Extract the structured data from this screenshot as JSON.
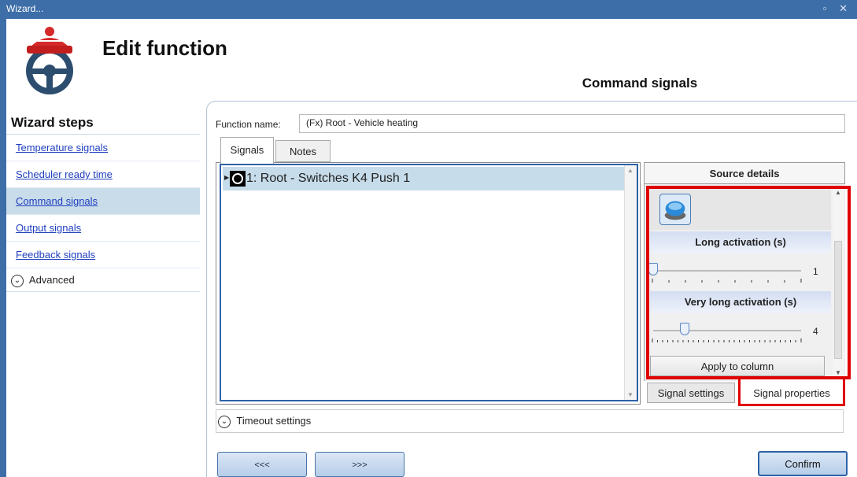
{
  "window": {
    "title": "Wizard...",
    "controls": "▫ ✕"
  },
  "header": {
    "title": "Edit function",
    "step_tab": "Command signals"
  },
  "sidebar": {
    "heading": "Wizard steps",
    "items": [
      {
        "label": "Temperature signals"
      },
      {
        "label": "Scheduler ready time"
      },
      {
        "label": "Command signals",
        "active": true
      },
      {
        "label": "Output signals"
      },
      {
        "label": "Feedback signals"
      }
    ],
    "advanced_label": "Advanced"
  },
  "form": {
    "function_name_label": "Function name:",
    "function_name_value": "(Fx) Root - Vehicle heating",
    "tabs": [
      {
        "label": "Signals"
      },
      {
        "label": "Notes"
      }
    ]
  },
  "signals": {
    "rows": [
      {
        "label": "1: Root - Switches K4 Push 1"
      }
    ]
  },
  "source": {
    "header": "Source details",
    "icon": "push-button-icon",
    "long_activation": {
      "title": "Long activation (s)",
      "value": "1",
      "min": 1,
      "max": 10
    },
    "very_long_activation": {
      "title": "Very long activation (s)",
      "value": "4",
      "min": 1,
      "max": 30
    },
    "apply_label": "Apply to column",
    "bottom_tabs": [
      {
        "label": "Signal settings"
      },
      {
        "label": "Signal properties"
      }
    ]
  },
  "timeout": {
    "label": "Timeout settings"
  },
  "footer": {
    "prev_label": "<<<",
    "next_label": ">>>",
    "confirm_label": "Confirm"
  },
  "colors": {
    "titlebar": "#3e6ea8",
    "highlight": "#e00000",
    "selection": "#c6dcea",
    "link": "#1f3fbf"
  }
}
